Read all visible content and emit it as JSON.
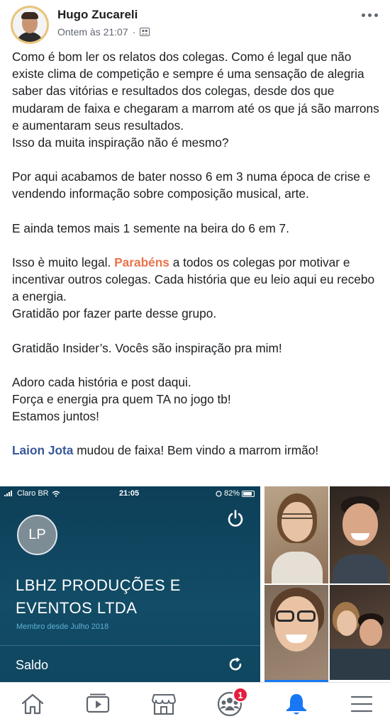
{
  "post": {
    "author": "Hugo Zucareli",
    "timestamp": "Ontem às 21:07",
    "privacy_separator": "·",
    "privacy_icon": "group-icon",
    "more_icon": "more-horizontal-icon",
    "paragraphs": {
      "p1": "Como é bom ler os relatos dos colegas. Como é legal que não existe clima de competição e sempre é uma sensação de alegria saber das vitórias e resultados dos colegas, desde dos que mudaram de faixa e chegaram a marrom até os que já são marrons e aumentaram seus resultados.",
      "p1b": "Isso da muita inspiração não é mesmo?",
      "p2": "Por aqui acabamos de bater nosso 6 em 3 numa época de crise e vendendo informação sobre composição musical, arte.",
      "p3": "E ainda temos mais 1 semente na beira do 6 em 7.",
      "p4_before": "Isso è muito legal. ",
      "p4_highlight": "Parabéns",
      "p4_after": " a todos os colegas por motivar e incentivar outros colegas. Cada história que eu leio aqui eu recebo a energia.",
      "p4b": "Gratidão por fazer parte desse grupo.",
      "p5": "Gratidão Insider’s. Vocês são inspiração pra mim!",
      "p6a": "Adoro cada história e post daqui.",
      "p6b": "Força e energia pra quem TA no jogo tb!",
      "p6c": "Estamos juntos!",
      "p7_mention": "Laion Jota",
      "p7_rest": " mudou de faixa! Bem vindo a marrom irmão!"
    },
    "colors": {
      "highlight": "#e8744b",
      "mention": "#385898"
    }
  },
  "screenshot": {
    "status_carrier": "Claro BR",
    "status_time": "21:05",
    "status_battery": "82%",
    "avatar_initials": "LP",
    "company_line1": "LBHZ PRODUÇÕES E",
    "company_line2": "EVENTOS LTDA",
    "member_since": "Membro desde Julho 2018",
    "balance_label": "Saldo",
    "background_color": "#0f4660"
  },
  "nav": {
    "items": [
      {
        "name": "home",
        "icon": "home-icon"
      },
      {
        "name": "watch",
        "icon": "video-icon"
      },
      {
        "name": "marketplace",
        "icon": "store-icon"
      },
      {
        "name": "groups",
        "icon": "groups-icon",
        "badge": "1"
      },
      {
        "name": "notifications",
        "icon": "bell-icon",
        "active": true
      },
      {
        "name": "menu",
        "icon": "menu-icon"
      }
    ],
    "groups_badge": "1",
    "active_color": "#1877f2"
  }
}
